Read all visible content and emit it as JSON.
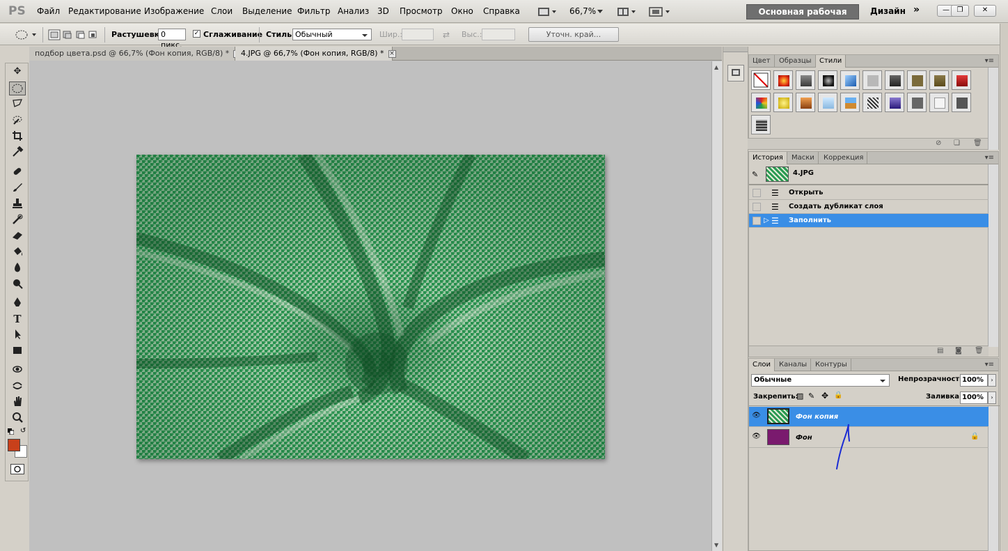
{
  "app": {
    "logo": "PS"
  },
  "menu": [
    "Файл",
    "Редактирование",
    "Изображение",
    "Слои",
    "Выделение",
    "Фильтр",
    "Анализ",
    "3D",
    "Просмотр",
    "Окно",
    "Справка"
  ],
  "toolbar_top": {
    "zoom": "66,7%",
    "workspace": "Основная рабочая среда",
    "design": "Дизайн",
    "more": "»"
  },
  "window": {
    "minimize": "—",
    "restore": "❐",
    "close": "✕"
  },
  "options": {
    "feather_label": "Растушевка:",
    "feather_value": "0 пикс.",
    "antialias_label": "Сглаживание",
    "antialias_checked": true,
    "style_label": "Стиль:",
    "style_value": "Обычный",
    "width_label": "Шир.:",
    "height_label": "Выс.:",
    "refine_edge": "Уточн. край..."
  },
  "tabs": [
    {
      "label": "подбор цвета.psd @ 66,7% (Фон копия, RGB/8) *",
      "active": false
    },
    {
      "label": "4.JPG @ 66,7% (Фон копия, RGB/8) *",
      "active": true
    }
  ],
  "tools": {
    "foreground_color": "#c8401a",
    "background_color": "#ffffff"
  },
  "image": {
    "pattern": "green houndstooth fabric swirl",
    "main_color": "#2f9a55"
  },
  "styles_panel": {
    "tabs": [
      "Цвет",
      "Образцы",
      "Стили"
    ],
    "active_tab": "Стили"
  },
  "history_panel": {
    "tabs": [
      "История",
      "Маски",
      "Коррекция"
    ],
    "active_tab": "История",
    "snapshot": "4.JPG",
    "items": [
      {
        "label": "Открыть",
        "selected": false
      },
      {
        "label": "Создать дубликат слоя",
        "selected": false
      },
      {
        "label": "Заполнить",
        "selected": true
      }
    ]
  },
  "layers_panel": {
    "tabs": [
      "Слои",
      "Каналы",
      "Контуры"
    ],
    "active_tab": "Слои",
    "blend_mode": "Обычные",
    "opacity_label": "Непрозрачность:",
    "opacity_value": "100%",
    "lock_label": "Закрепить:",
    "fill_label": "Заливка:",
    "fill_value": "100%",
    "layers": [
      {
        "name": "Фон копия",
        "selected": true,
        "thumb": "#3e9a62"
      },
      {
        "name": "Фон",
        "selected": false,
        "thumb": "#7a1a6e",
        "locked": true
      }
    ]
  },
  "colors": {
    "accent": "#3a8ee6",
    "annotation": "#1a2bd4",
    "workspace_btn": "#6f6f6f"
  }
}
